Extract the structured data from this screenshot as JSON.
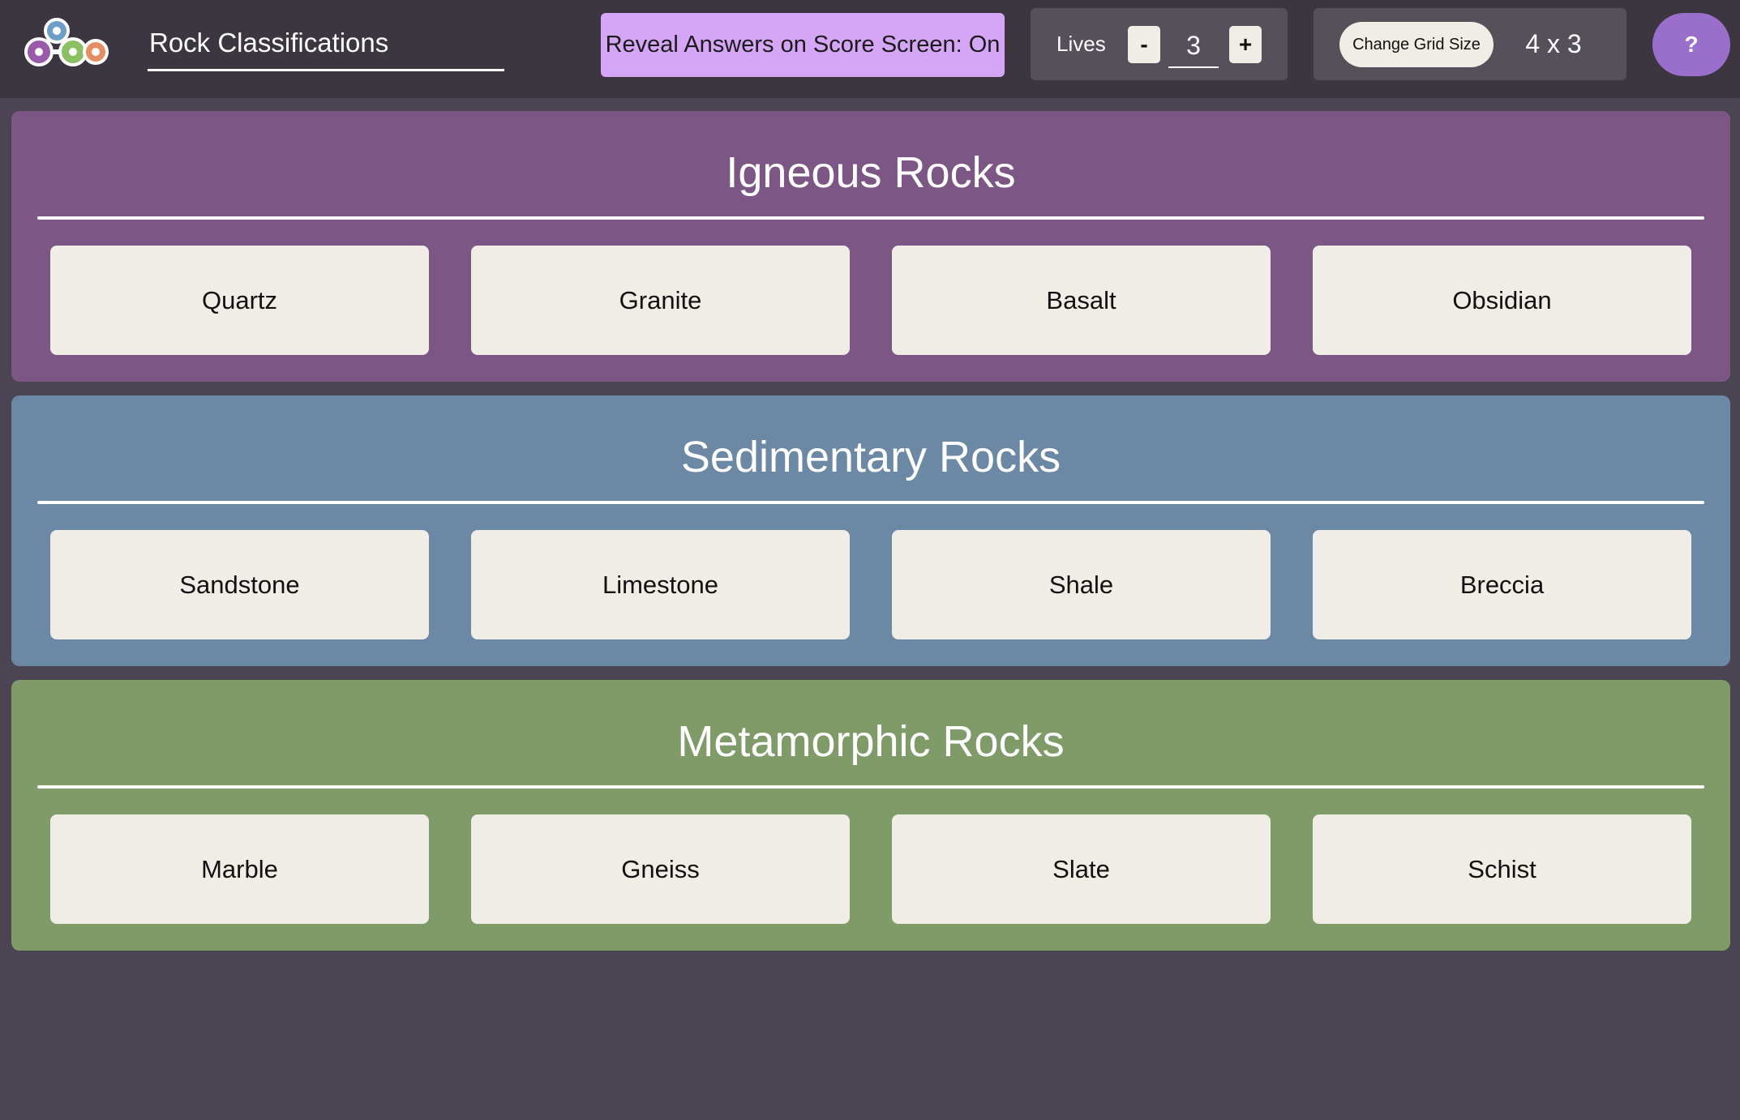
{
  "header": {
    "title": "Rock Classifications",
    "reveal_label": "Reveal Answers on Score Screen: On",
    "lives_label": "Lives",
    "lives_minus": "-",
    "lives_value": "3",
    "lives_plus": "+",
    "grid_button_label": "Change Grid Size",
    "grid_size": "4 x 3",
    "help_label": "?"
  },
  "groups": [
    {
      "title": "Igneous Rocks",
      "color": "#7c5685",
      "items": [
        "Quartz",
        "Granite",
        "Basalt",
        "Obsidian"
      ]
    },
    {
      "title": "Sedimentary Rocks",
      "color": "#6b88a5",
      "items": [
        "Sandstone",
        "Limestone",
        "Shale",
        "Breccia"
      ]
    },
    {
      "title": "Metamorphic Rocks",
      "color": "#7f9c68",
      "items": [
        "Marble",
        "Gneiss",
        "Slate",
        "Schist"
      ]
    }
  ],
  "colors": {
    "background": "#4a4453",
    "topbar": "#3b3640",
    "reveal_button": "#d4a6f5",
    "help_button": "#9a6ecb",
    "card": "#efede6"
  },
  "icons": {
    "logo": "connected-circles-logo"
  }
}
